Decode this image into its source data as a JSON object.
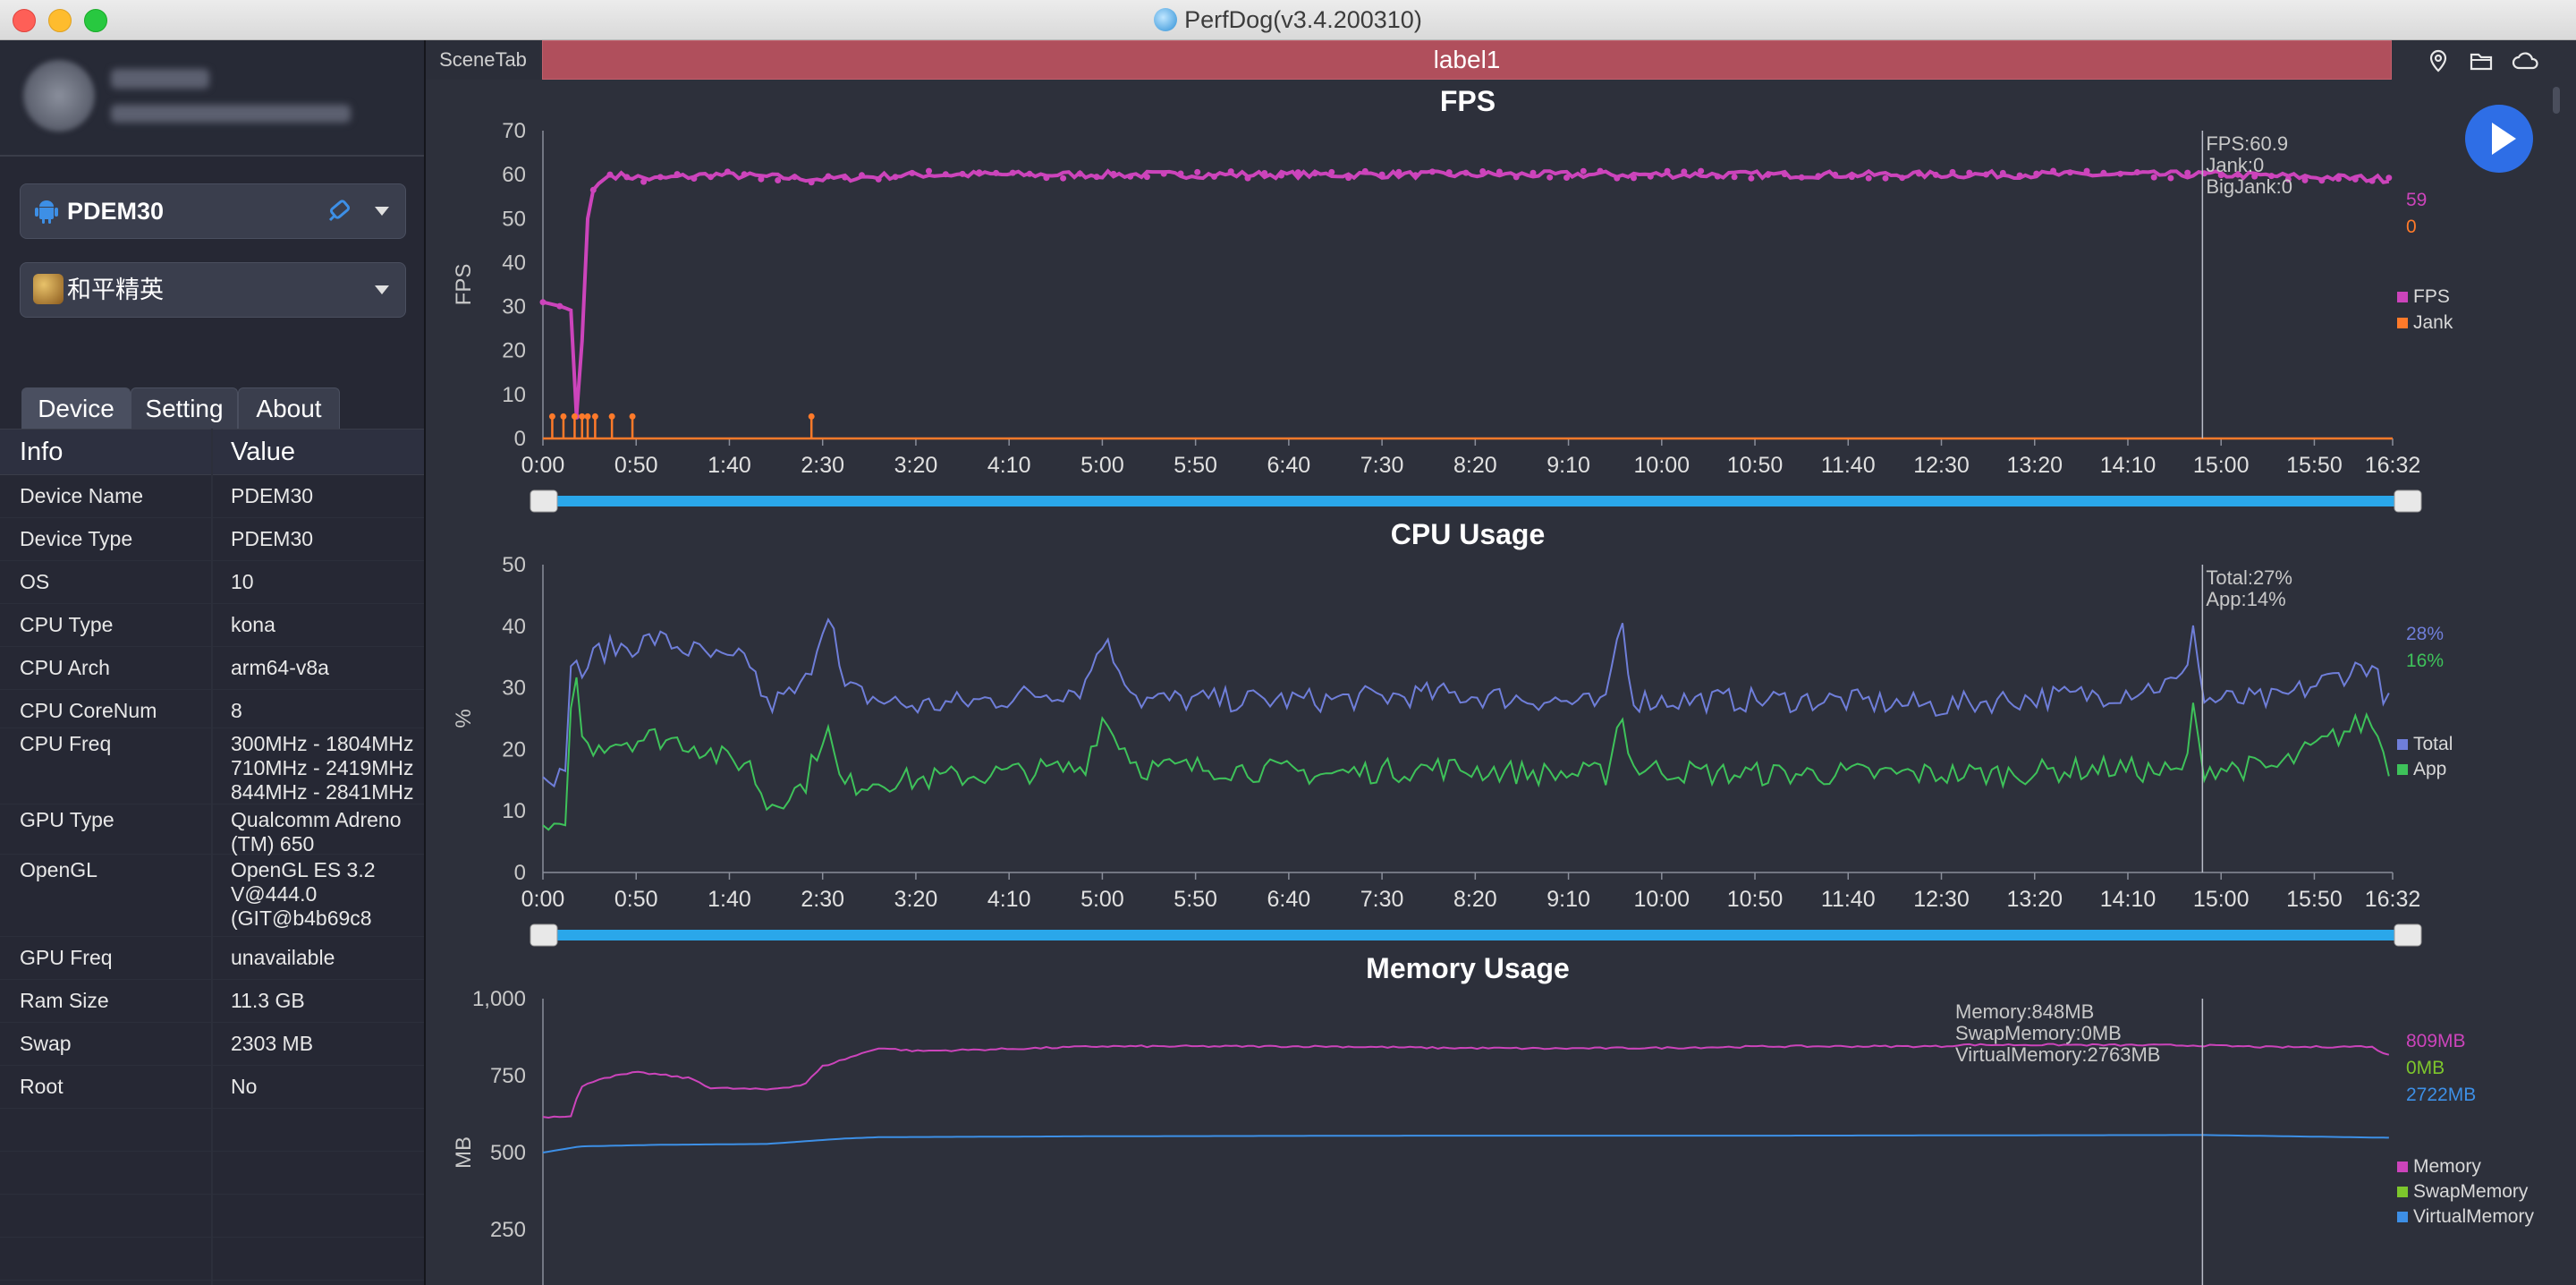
{
  "window": {
    "title": "PerfDog(v3.4.200310)"
  },
  "sidebar": {
    "device_selector": {
      "label": "PDEM30"
    },
    "app_selector": {
      "label": "和平精英"
    },
    "tabs": [
      {
        "label": "Device"
      },
      {
        "label": "Setting"
      },
      {
        "label": "About"
      }
    ],
    "info_header": {
      "key": "Info",
      "value": "Value"
    },
    "info_rows": [
      {
        "key": "Device Name",
        "value": "PDEM30"
      },
      {
        "key": "Device Type",
        "value": "PDEM30"
      },
      {
        "key": "OS",
        "value": "10"
      },
      {
        "key": "CPU Type",
        "value": "kona"
      },
      {
        "key": "CPU Arch",
        "value": "arm64-v8a"
      },
      {
        "key": "CPU CoreNum",
        "value": "8"
      },
      {
        "key": "CPU Freq",
        "value": "300MHz - 1804MHz\n710MHz - 2419MHz\n844MHz - 2841MHz"
      },
      {
        "key": "GPU Type",
        "value": "Qualcomm Adreno\n(TM) 650"
      },
      {
        "key": "OpenGL",
        "value": "OpenGL ES 3.2\nV@444.0\n(GIT@b4b69c8"
      },
      {
        "key": "GPU Freq",
        "value": "unavailable"
      },
      {
        "key": "Ram Size",
        "value": "11.3 GB"
      },
      {
        "key": "Swap",
        "value": "2303 MB"
      },
      {
        "key": "Root",
        "value": "No"
      }
    ]
  },
  "topbar": {
    "scene_tab": "SceneTab",
    "label": "label1",
    "icons": [
      "location-icon",
      "folder-icon",
      "cloud-icon"
    ]
  },
  "colors": {
    "fps": "#cc44bb",
    "jank": "#ff7a2a",
    "total": "#6f7ed9",
    "app": "#3ec25a",
    "memory": "#cc44bb",
    "swap": "#7dc62c",
    "virtual": "#3d8fe6",
    "accent": "#2e6ee6",
    "label_bar": "#b04f5c",
    "slider": "#2aa7ea"
  },
  "time_ticks": [
    "0:00",
    "0:50",
    "1:40",
    "2:30",
    "3:20",
    "4:10",
    "5:00",
    "5:50",
    "6:40",
    "7:30",
    "8:20",
    "9:10",
    "10:00",
    "10:50",
    "11:40",
    "12:30",
    "13:20",
    "14:10",
    "15:00",
    "15:50",
    "16:32"
  ],
  "chart_data": [
    {
      "type": "line",
      "title": "FPS",
      "ylabel": "FPS",
      "xlim": [
        "0:00",
        "16:32"
      ],
      "ylim": [
        0,
        70
      ],
      "y_ticks": [
        "70",
        "60",
        "50",
        "40",
        "30",
        "20",
        "10",
        "0"
      ],
      "cursor": {
        "time": "14:50",
        "readout": [
          "FPS:60.9",
          "Jank:0",
          "BigJank:0"
        ]
      },
      "series": [
        {
          "name": "FPS",
          "current": "59",
          "points": [
            [
              "0:00",
              31
            ],
            [
              "0:10",
              30
            ],
            [
              "0:16",
              29
            ],
            [
              "0:18",
              5
            ],
            [
              "0:22",
              28
            ],
            [
              "0:24",
              50
            ],
            [
              "0:26",
              56
            ],
            [
              "0:30",
              58
            ],
            [
              "0:36",
              60
            ],
            [
              "1:00",
              59
            ],
            [
              "1:30",
              60
            ],
            [
              "2:30",
              59
            ],
            [
              "3:20",
              60
            ],
            [
              "5:00",
              60
            ],
            [
              "7:30",
              60
            ],
            [
              "10:00",
              60
            ],
            [
              "12:30",
              60
            ],
            [
              "15:00",
              60
            ],
            [
              "16:32",
              59
            ]
          ]
        },
        {
          "name": "Jank",
          "current": "0",
          "spikes": [
            [
              "0:05",
              5
            ],
            [
              "0:11",
              5
            ],
            [
              "0:17",
              5
            ],
            [
              "0:21",
              5
            ],
            [
              "0:24",
              5
            ],
            [
              "0:28",
              5
            ],
            [
              "0:37",
              5
            ],
            [
              "0:48",
              5
            ],
            [
              "2:24",
              5
            ]
          ]
        }
      ]
    },
    {
      "type": "line",
      "title": "CPU Usage",
      "ylabel": "%",
      "xlim": [
        "0:00",
        "16:32"
      ],
      "ylim": [
        0,
        50
      ],
      "y_ticks": [
        "50",
        "40",
        "30",
        "20",
        "10",
        "0"
      ],
      "cursor": {
        "time": "14:50",
        "readout": [
          "Total:27%",
          "App:14%"
        ]
      },
      "series": [
        {
          "name": "Total",
          "current": "28%",
          "points": [
            [
              "0:00",
              17
            ],
            [
              "0:12",
              15
            ],
            [
              "0:14",
              36
            ],
            [
              "0:20",
              32
            ],
            [
              "0:30",
              36
            ],
            [
              "0:50",
              37
            ],
            [
              "1:00",
              38
            ],
            [
              "1:20",
              36
            ],
            [
              "1:40",
              34
            ],
            [
              "1:50",
              35
            ],
            [
              "2:00",
              27
            ],
            [
              "2:20",
              30
            ],
            [
              "2:34",
              44
            ],
            [
              "2:40",
              30
            ],
            [
              "3:00",
              28
            ],
            [
              "3:20",
              27
            ],
            [
              "4:00",
              28
            ],
            [
              "4:50",
              30
            ],
            [
              "5:00",
              38
            ],
            [
              "5:20",
              28
            ],
            [
              "6:00",
              28
            ],
            [
              "7:00",
              28
            ],
            [
              "8:00",
              29
            ],
            [
              "9:00",
              28
            ],
            [
              "9:30",
              27
            ],
            [
              "9:38",
              42
            ],
            [
              "9:45",
              28
            ],
            [
              "10:30",
              28
            ],
            [
              "11:30",
              28
            ],
            [
              "12:30",
              27
            ],
            [
              "13:00",
              28
            ],
            [
              "14:00",
              29
            ],
            [
              "14:40",
              31
            ],
            [
              "14:45",
              41
            ],
            [
              "14:50",
              28
            ],
            [
              "15:30",
              28
            ],
            [
              "16:20",
              34
            ],
            [
              "16:32",
              26
            ]
          ]
        },
        {
          "name": "App",
          "current": "16%",
          "points": [
            [
              "0:00",
              7
            ],
            [
              "0:12",
              6
            ],
            [
              "0:16",
              36
            ],
            [
              "0:22",
              20
            ],
            [
              "0:30",
              21
            ],
            [
              "1:00",
              22
            ],
            [
              "1:20",
              21
            ],
            [
              "1:40",
              18
            ],
            [
              "1:50",
              18
            ],
            [
              "2:00",
              11
            ],
            [
              "2:20",
              14
            ],
            [
              "2:32",
              24
            ],
            [
              "2:40",
              14
            ],
            [
              "3:00",
              15
            ],
            [
              "3:20",
              15
            ],
            [
              "4:00",
              16
            ],
            [
              "4:50",
              17
            ],
            [
              "5:00",
              25
            ],
            [
              "5:20",
              17
            ],
            [
              "6:00",
              17
            ],
            [
              "7:00",
              16
            ],
            [
              "8:00",
              17
            ],
            [
              "9:00",
              16
            ],
            [
              "9:30",
              16
            ],
            [
              "9:38",
              26
            ],
            [
              "9:45",
              17
            ],
            [
              "10:30",
              16
            ],
            [
              "11:30",
              16
            ],
            [
              "12:30",
              16
            ],
            [
              "13:00",
              16
            ],
            [
              "14:00",
              17
            ],
            [
              "14:40",
              16
            ],
            [
              "14:45",
              26
            ],
            [
              "14:50",
              17
            ],
            [
              "15:30",
              17
            ],
            [
              "16:20",
              25
            ],
            [
              "16:32",
              16
            ]
          ]
        }
      ]
    },
    {
      "type": "line",
      "title": "Memory Usage",
      "ylabel": "MB",
      "xlim": [
        "0:00",
        "16:32"
      ],
      "ylim": [
        0,
        1000
      ],
      "y_ticks": [
        "1,000",
        "750",
        "500",
        "250"
      ],
      "cursor": {
        "time": "14:50",
        "readout": [
          "Memory:848MB",
          "SwapMemory:0MB",
          "VirtualMemory:2763MB"
        ]
      },
      "series": [
        {
          "name": "Memory",
          "current": "809MB",
          "points": [
            [
              "0:00",
              615
            ],
            [
              "0:15",
              620
            ],
            [
              "0:20",
              710
            ],
            [
              "0:30",
              740
            ],
            [
              "0:50",
              760
            ],
            [
              "1:00",
              755
            ],
            [
              "1:20",
              740
            ],
            [
              "1:30",
              710
            ],
            [
              "2:00",
              705
            ],
            [
              "2:20",
              720
            ],
            [
              "2:30",
              780
            ],
            [
              "2:40",
              800
            ],
            [
              "3:00",
              840
            ],
            [
              "3:20",
              830
            ],
            [
              "4:00",
              835
            ],
            [
              "5:00",
              845
            ],
            [
              "6:00",
              845
            ],
            [
              "7:00",
              845
            ],
            [
              "8:00",
              840
            ],
            [
              "9:00",
              838
            ],
            [
              "10:00",
              840
            ],
            [
              "11:00",
              845
            ],
            [
              "12:30",
              845
            ],
            [
              "12:40",
              850
            ],
            [
              "13:30",
              850
            ],
            [
              "14:50",
              848
            ],
            [
              "15:30",
              842
            ],
            [
              "16:20",
              845
            ],
            [
              "16:32",
              810
            ]
          ]
        },
        {
          "name": "SwapMemory",
          "current": "0MB",
          "points": [
            [
              "0:00",
              0
            ],
            [
              "16:32",
              0
            ]
          ]
        },
        {
          "name": "VirtualMemory",
          "current": "2722MB",
          "points": [
            [
              "0:00",
              500
            ],
            [
              "0:20",
              520
            ],
            [
              "1:00",
              525
            ],
            [
              "2:00",
              528
            ],
            [
              "2:40",
              545
            ],
            [
              "3:00",
              550
            ],
            [
              "5:00",
              553
            ],
            [
              "8:00",
              555
            ],
            [
              "11:00",
              555
            ],
            [
              "14:50",
              557
            ],
            [
              "16:32",
              548
            ]
          ]
        }
      ]
    }
  ]
}
